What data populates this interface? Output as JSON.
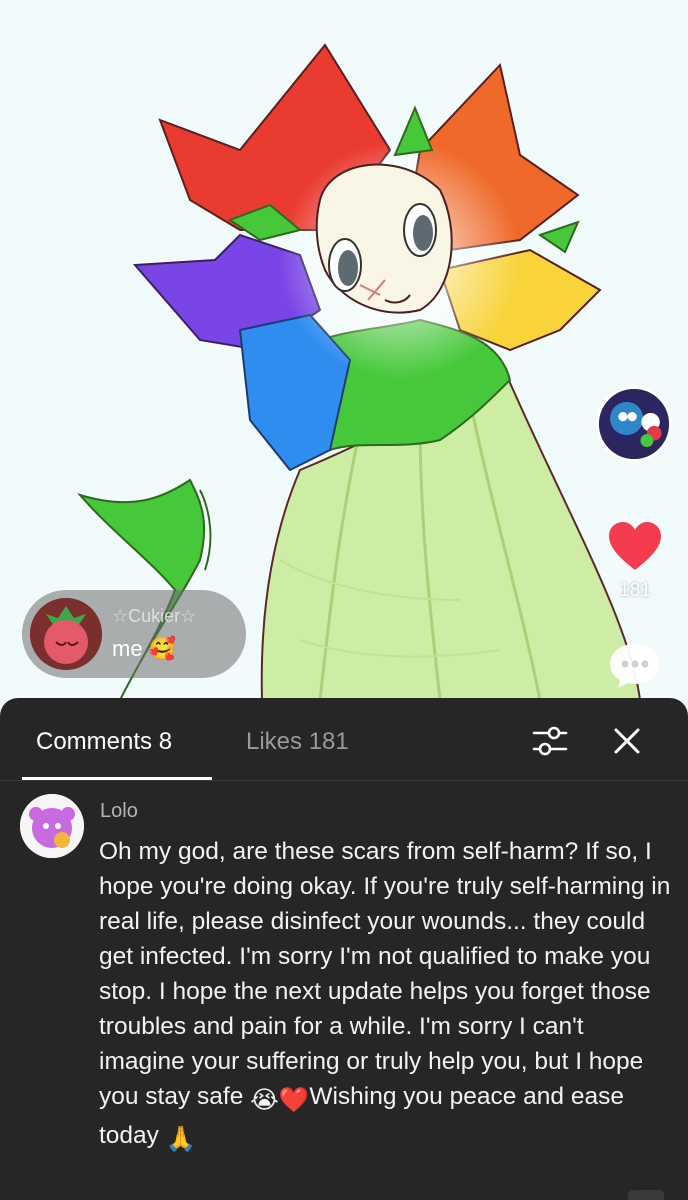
{
  "post": {
    "like_count": "181",
    "live_comment": {
      "username": "☆Cukier☆",
      "text": "me 🥰"
    }
  },
  "comments_panel": {
    "tabs": [
      {
        "label": "Comments 8",
        "active": true
      },
      {
        "label": "Likes 181",
        "active": false
      }
    ],
    "comments": [
      {
        "username": "Lolo",
        "text_part1": "Oh my god, are these scars from self-harm? If so, I hope you're doing okay. If you're truly self-harming in real life, please disinfect your wounds... they could get infected. I'm sorry I'm not qualified to make you stop. I hope the next update helps you forget those troubles and pain for a while. I'm sorry I can't imagine your suffering or truly help you, but I hope you stay safe ",
        "emoji_crying": "😭",
        "emoji_heart": "❤️",
        "text_part2": "Wishing you peace and ease today ",
        "emoji_pray": "🙏"
      }
    ]
  },
  "icons": {
    "like": "heart-icon",
    "comment": "comment-bubble-icon",
    "filter": "sliders-icon",
    "close": "close-icon"
  },
  "colors": {
    "like_heart": "#f53c4f",
    "panel_background": "#262626",
    "canvas_background": "#f2fbfb"
  }
}
